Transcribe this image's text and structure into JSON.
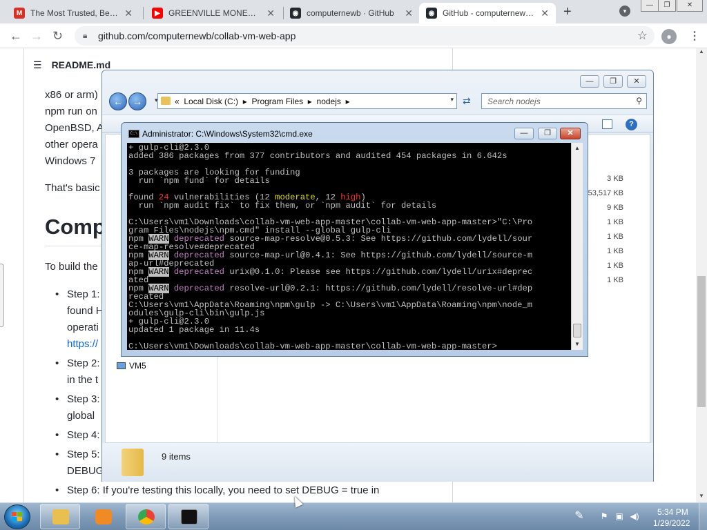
{
  "browser": {
    "tabs": [
      {
        "title": "The Most Trusted, Best-P",
        "icon": "gmail-icon",
        "color": "#d93025",
        "letter": "M",
        "active": false
      },
      {
        "title": "GREENVILLE MONEY SCR",
        "icon": "youtube-icon",
        "color": "#ff0000",
        "letter": "▶",
        "active": false
      },
      {
        "title": "computernewb · GitHub",
        "icon": "github-icon",
        "color": "#24292f",
        "letter": "◉",
        "active": false
      },
      {
        "title": "GitHub - computernewb/c",
        "icon": "github-icon",
        "color": "#24292f",
        "letter": "◉",
        "active": true
      }
    ],
    "url": "github.com/computernewb/collab-vm-web-app"
  },
  "page": {
    "readme_title": "README.md",
    "paragraph_lines": [
      "x86 or arm)",
      "npm run on",
      "OpenBSD, A",
      "other opera",
      "Windows 7"
    ],
    "basics_line": "That's basic",
    "heading": "Comp",
    "build_line": "To build the",
    "steps": [
      "Step 1:",
      "found H",
      "operati",
      "https://",
      "Step 2:",
      "in the t",
      "Step 3:",
      "global",
      "Step 4:",
      "Step 5:",
      "DEBUG",
      "Step 6: If you're testing this locally, you need to set DEBUG = true in"
    ]
  },
  "explorer": {
    "path": [
      "Local Disk (C:)",
      "Program Files",
      "nodejs"
    ],
    "search_placeholder": "Search nodejs",
    "nav_item": "VM5",
    "sizes": [
      "3 KB",
      "53,517 KB",
      "9 KB",
      "1 KB",
      "1 KB",
      "1 KB",
      "1 KB",
      "1 KB"
    ],
    "item_count": "9 items"
  },
  "cmd": {
    "title": "Administrator: C:\\Windows\\System32\\cmd.exe",
    "lines": [
      [
        {
          "t": "+ gulp-cli@2.3.0"
        }
      ],
      [
        {
          "t": "added 386 packages from 377 contributors and audited 454 packages in 6.642s"
        }
      ],
      [
        {
          "t": ""
        }
      ],
      [
        {
          "t": "3 packages are looking for funding"
        }
      ],
      [
        {
          "t": "  run `npm fund` for details"
        }
      ],
      [
        {
          "t": ""
        }
      ],
      [
        {
          "t": "found "
        },
        {
          "t": "24",
          "c": "r"
        },
        {
          "t": " vulnerabilities (12 "
        },
        {
          "t": "moderate",
          "c": "y"
        },
        {
          "t": ", 12 "
        },
        {
          "t": "high",
          "c": "r"
        },
        {
          "t": ")"
        }
      ],
      [
        {
          "t": "  run `npm audit fix` to fix them, or `npm audit` for details"
        }
      ],
      [
        {
          "t": ""
        }
      ],
      [
        {
          "t": "C:\\Users\\vm1\\Downloads\\collab-vm-web-app-master\\collab-vm-web-app-master>\"C:\\Pro"
        }
      ],
      [
        {
          "t": "gram Files\\nodejs\\npm.cmd\" install --global gulp-cli"
        }
      ],
      [
        {
          "t": "npm "
        },
        {
          "t": "WARN",
          "c": "warn"
        },
        {
          "t": " "
        },
        {
          "t": "deprecated",
          "c": "m"
        },
        {
          "t": " source-map-resolve@0.5.3: See https://github.com/lydell/sour"
        }
      ],
      [
        {
          "t": "ce-map-resolve#deprecated"
        }
      ],
      [
        {
          "t": "npm "
        },
        {
          "t": "WARN",
          "c": "warn"
        },
        {
          "t": " "
        },
        {
          "t": "deprecated",
          "c": "m"
        },
        {
          "t": " source-map-url@0.4.1: See https://github.com/lydell/source-m"
        }
      ],
      [
        {
          "t": "ap-url#deprecated"
        }
      ],
      [
        {
          "t": "npm "
        },
        {
          "t": "WARN",
          "c": "warn"
        },
        {
          "t": " "
        },
        {
          "t": "deprecated",
          "c": "m"
        },
        {
          "t": " urix@0.1.0: Please see https://github.com/lydell/urix#deprec"
        }
      ],
      [
        {
          "t": "ated"
        }
      ],
      [
        {
          "t": "npm "
        },
        {
          "t": "WARN",
          "c": "warn"
        },
        {
          "t": " "
        },
        {
          "t": "deprecated",
          "c": "m"
        },
        {
          "t": " resolve-url@0.2.1: https://github.com/lydell/resolve-url#dep"
        }
      ],
      [
        {
          "t": "recated"
        }
      ],
      [
        {
          "t": "C:\\Users\\vm1\\AppData\\Roaming\\npm\\gulp -> C:\\Users\\vm1\\AppData\\Roaming\\npm\\node_m"
        }
      ],
      [
        {
          "t": "odules\\gulp-cli\\bin\\gulp.js"
        }
      ],
      [
        {
          "t": "+ gulp-cli@2.3.0"
        }
      ],
      [
        {
          "t": "updated 1 package in 11.4s"
        }
      ],
      [
        {
          "t": ""
        }
      ],
      [
        {
          "t": "C:\\Users\\vm1\\Downloads\\collab-vm-web-app-master\\collab-vm-web-app-master>"
        }
      ]
    ]
  },
  "taskbar": {
    "apps": [
      {
        "name": "explorer",
        "color": "#e9c04f"
      },
      {
        "name": "media-player",
        "color": "#f08a24"
      },
      {
        "name": "chrome",
        "color": "#34a853"
      },
      {
        "name": "cmd",
        "color": "#111111"
      }
    ],
    "time": "5:34 PM",
    "date": "1/29/2022"
  }
}
